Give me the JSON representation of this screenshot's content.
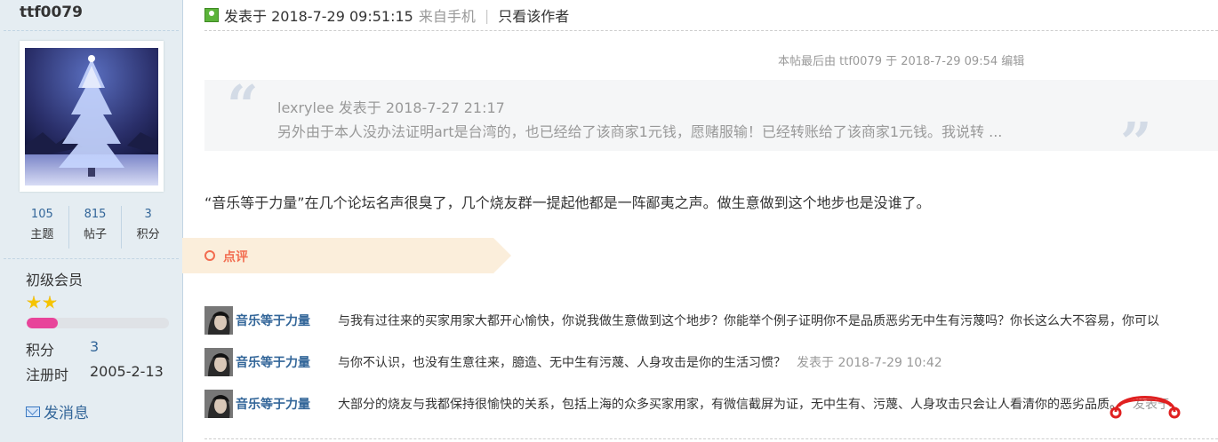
{
  "sidebar": {
    "username": "ttf0079",
    "stats": [
      {
        "num": "105",
        "label": "主题"
      },
      {
        "num": "815",
        "label": "帖子"
      },
      {
        "num": "3",
        "label": "积分"
      }
    ],
    "level": "初级会员",
    "stars": 2,
    "progress_percent": 22,
    "progress_color": "#e8449a",
    "points_label": "积分",
    "points_value": "3",
    "reg_label": "注册时",
    "reg_value": "2005-2-13",
    "message_label": "发消息"
  },
  "post": {
    "posted_at": "发表于 2018-7-29 09:51:15",
    "via": "来自手机",
    "separator": "|",
    "only_author": "只看该作者",
    "edit_note": "本帖最后由 ttf0079 于 2018-7-29 09:54 编辑",
    "quote_author": "lexrylee 发表于 2018-7-27 21:17",
    "quote_text": "另外由于本人没办法证明art是台湾的，也已经给了该商家1元钱，愿赌服输！已经转账给了该商家1元钱。我说转 ...",
    "body": "“音乐等于力量”在几个论坛名声很臭了，几个烧友群一提起他都是一阵鄙夷之声。做生意做到这个地步也是没谁了。"
  },
  "comments_header": "点评",
  "comments": [
    {
      "name": "音乐等于力量",
      "text": "与我有过往来的买家用家大都开心愉快，你说我做生意做到这个地步？你能举个例子证明你不是品质恶劣无中生有污蔑吗？你长这么大不容易，你可以",
      "time": ""
    },
    {
      "name": "音乐等于力量",
      "text": "与你不认识，也没有生意往来，臆造、无中生有污蔑、人身攻击是你的生活习惯？",
      "time": "发表于 2018-7-29 10:42"
    },
    {
      "name": "音乐等于力量",
      "text": "大部分的烧友与我都保持很愉快的关系，包括上海的众多买家用家，有微信截屏为证，无中生有、污蔑、人身攻击只会让人看清你的恶劣品质。",
      "time": "发表于"
    }
  ],
  "icons": [
    "online-icon",
    "quote-open-icon",
    "quote-close-icon",
    "comment-icon",
    "star-icon",
    "envelope-icon",
    "headphone-icon"
  ],
  "colors": {
    "link": "#336699",
    "accent": "#f26c4f",
    "sidebar_bg": "#e5edf2"
  }
}
